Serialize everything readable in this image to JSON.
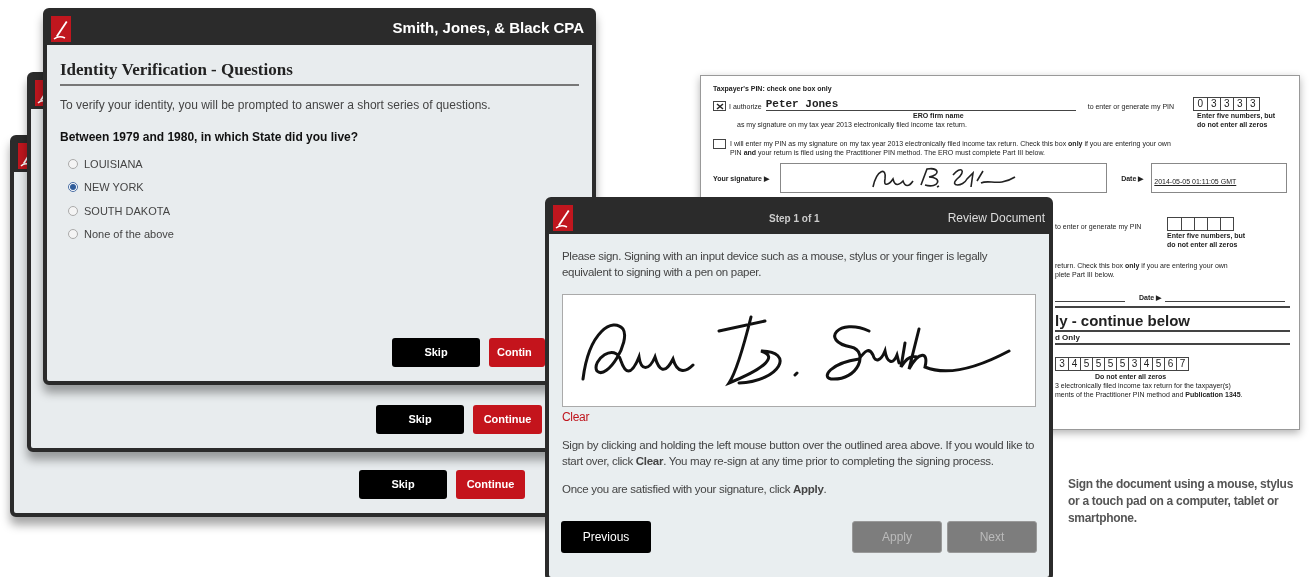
{
  "stacked_windows": [
    {
      "buttons": [
        {
          "label": "Skip",
          "kind": "secondary"
        },
        {
          "label": "Continue",
          "kind": "primary"
        }
      ]
    },
    {
      "buttons": [
        {
          "label": "Skip",
          "kind": "secondary"
        },
        {
          "label": "Continue",
          "kind": "primary"
        }
      ]
    }
  ],
  "identity_window": {
    "title": "Smith, Jones, & Black CPA",
    "heading": "Identity Verification - Questions",
    "intro": "To verify your identity, you will be prompted to answer a short series of questions.",
    "question": "Between 1979 and 1980, in which State did you live?",
    "options": [
      {
        "label": "LOUISIANA",
        "selected": false
      },
      {
        "label": "NEW YORK",
        "selected": true
      },
      {
        "label": "SOUTH DAKOTA",
        "selected": false
      },
      {
        "label": "None of the above",
        "selected": false
      }
    ],
    "buttons": [
      {
        "label": "Skip",
        "kind": "secondary"
      },
      {
        "label": "Contin",
        "kind": "primary"
      }
    ]
  },
  "tax_form": {
    "heading": "Taxpayer's PIN: check one box only",
    "option_1": {
      "checked": true,
      "lead": "I authorize",
      "ero_name": "Peter Jones",
      "ero_label": "ERO firm name",
      "pin_label": "to enter or generate my PIN",
      "pin": [
        "0",
        "3",
        "3",
        "3",
        "3"
      ],
      "pin_note": [
        "Enter five numbers, but",
        "do not enter all zeros"
      ],
      "tail": "as my signature on my tax year 2013 electronically filed income tax return."
    },
    "option_2": {
      "checked": false,
      "lines": [
        "I will enter my PIN as my signature on my tax year 2013 electronically filed income tax return. Check this box **only** if you are entering your own",
        "PIN **and** your return is filed using the Practitioner PIN method. The ERO must complete Part III below."
      ]
    },
    "signature_label": "Your signature ▶",
    "date_label": "Date ▶",
    "date": "2014-05-05 01:11:05 GMT",
    "part_2": {
      "pin_label": "to enter or generate my PIN",
      "pin_note": [
        "Enter five numbers, but",
        "do not enter all zeros"
      ],
      "lines": [
        "return. Check this box **only** if you are entering your own",
        "plete Part III below."
      ],
      "date_label": "Date ▶",
      "heading": "ly - continue below",
      "subheading": "d Only",
      "digits": [
        "3",
        "4",
        "5",
        "5",
        "5",
        "5",
        "3",
        "4",
        "5",
        "6",
        "7"
      ],
      "digits_note": "Do not enter all zeros",
      "tail": [
        "3 electronically filed income tax return for the taxpayer(s)",
        "ments of the Practitioner PIN method and **Publication 1345**."
      ]
    }
  },
  "signing_window": {
    "step": "Step 1 of 1",
    "title": "Review Document",
    "instructions": "Please sign. Signing with an input device such as a mouse, stylus or your finger is legally equivalent to signing with a pen on paper.",
    "clear_link": "Clear",
    "help": "Sign by clicking and holding the left mouse button over the outlined area above. If you would like to start over, click **Clear**. You may re-sign at any time prior to completing the signing process.",
    "confirm": "Once you are satisfied with your signature, click **Apply**.",
    "buttons": [
      {
        "label": "Previous",
        "disabled": false
      },
      {
        "label": "Apply",
        "disabled": true
      },
      {
        "label": "Next",
        "disabled": true
      }
    ]
  },
  "caption": "Sign the document using a mouse, stylus or a touch pad on a computer, tablet or smartphone."
}
